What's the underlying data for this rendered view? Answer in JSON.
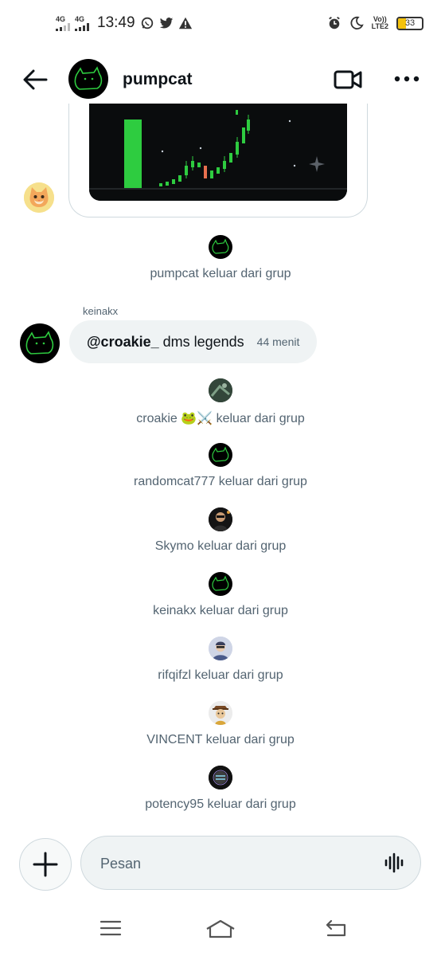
{
  "status_bar": {
    "sim1": "4G",
    "sim2": "4G",
    "time": "13:49",
    "volte_top": "Vo))",
    "volte_bottom": "LTE2",
    "battery": "33",
    "battery_color": "#f4c20d"
  },
  "header": {
    "title": "pumpcat"
  },
  "events": {
    "pumpcat_left": "pumpcat keluar dari grup",
    "croakie_left": "croakie 🐸⚔️ keluar dari grup",
    "randomcat_left": "randomcat777 keluar dari grup",
    "skymo_left": "Skymo keluar dari grup",
    "keinakx_left": "keinakx keluar dari grup",
    "rifqifzl_left": "rifqifzl keluar dari grup",
    "vincent_left": "VINCENT keluar dari grup",
    "potency_left": "potency95 keluar dari grup"
  },
  "message": {
    "sender": "keinakx",
    "mention": "@croakie_",
    "body": "dms legends",
    "time": "44 menit"
  },
  "composer": {
    "placeholder": "Pesan"
  },
  "colors": {
    "accent_green": "#2ecc40",
    "muted_text": "#536471",
    "bubble_bg": "#eff3f4"
  }
}
